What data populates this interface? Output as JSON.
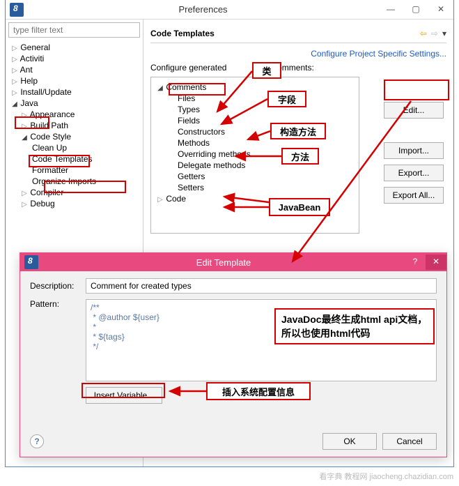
{
  "pref": {
    "title": "Preferences",
    "filter_placeholder": "type filter text",
    "tree": {
      "general": "General",
      "activiti": "Activiti",
      "ant": "Ant",
      "help": "Help",
      "install": "Install/Update",
      "java": "Java",
      "appearance": "Appearance",
      "buildpath": "Build Path",
      "codestyle": "Code Style",
      "cleanup": "Clean Up",
      "codetemplates": "Code Templates",
      "formatter": "Formatter",
      "organize": "Organize Imports",
      "compiler": "Compiler",
      "debug": "Debug"
    },
    "right": {
      "title": "Code Templates",
      "cfg_link": "Configure Project Specific Settings...",
      "cfg_line_pre": "Configure generated",
      "cfg_line_post": "comments:",
      "tree": {
        "comments": "Comments",
        "files": "Files",
        "types": "Types",
        "fields": "Fields",
        "constructors": "Constructors",
        "methods": "Methods",
        "overriding": "Overriding methods",
        "delegate": "Delegate methods",
        "getters": "Getters",
        "setters": "Setters",
        "code": "Code"
      },
      "btn_edit": "Edit...",
      "btn_import": "Import...",
      "btn_export": "Export...",
      "btn_exportall": "Export All..."
    }
  },
  "dlg": {
    "title": "Edit Template",
    "desc_label": "Description:",
    "desc_value": "Comment for created types",
    "pattern_label": "Pattern:",
    "pattern_lines": [
      "/**",
      " * @author ${user}",
      " *",
      " * ${tags}",
      " */"
    ],
    "insert_variable": "Insert Variable...",
    "ok": "OK",
    "cancel": "Cancel"
  },
  "ann": {
    "class": "类",
    "field": "字段",
    "ctor": "构造方法",
    "method": "方法",
    "javabean": "JavaBean",
    "javadoc": "JavaDoc最终生成html api文档，所以也使用html代码",
    "insertvar": "插入系统配置信息"
  },
  "watermark": "看字典 教程网 jiaocheng.chazidian.com"
}
